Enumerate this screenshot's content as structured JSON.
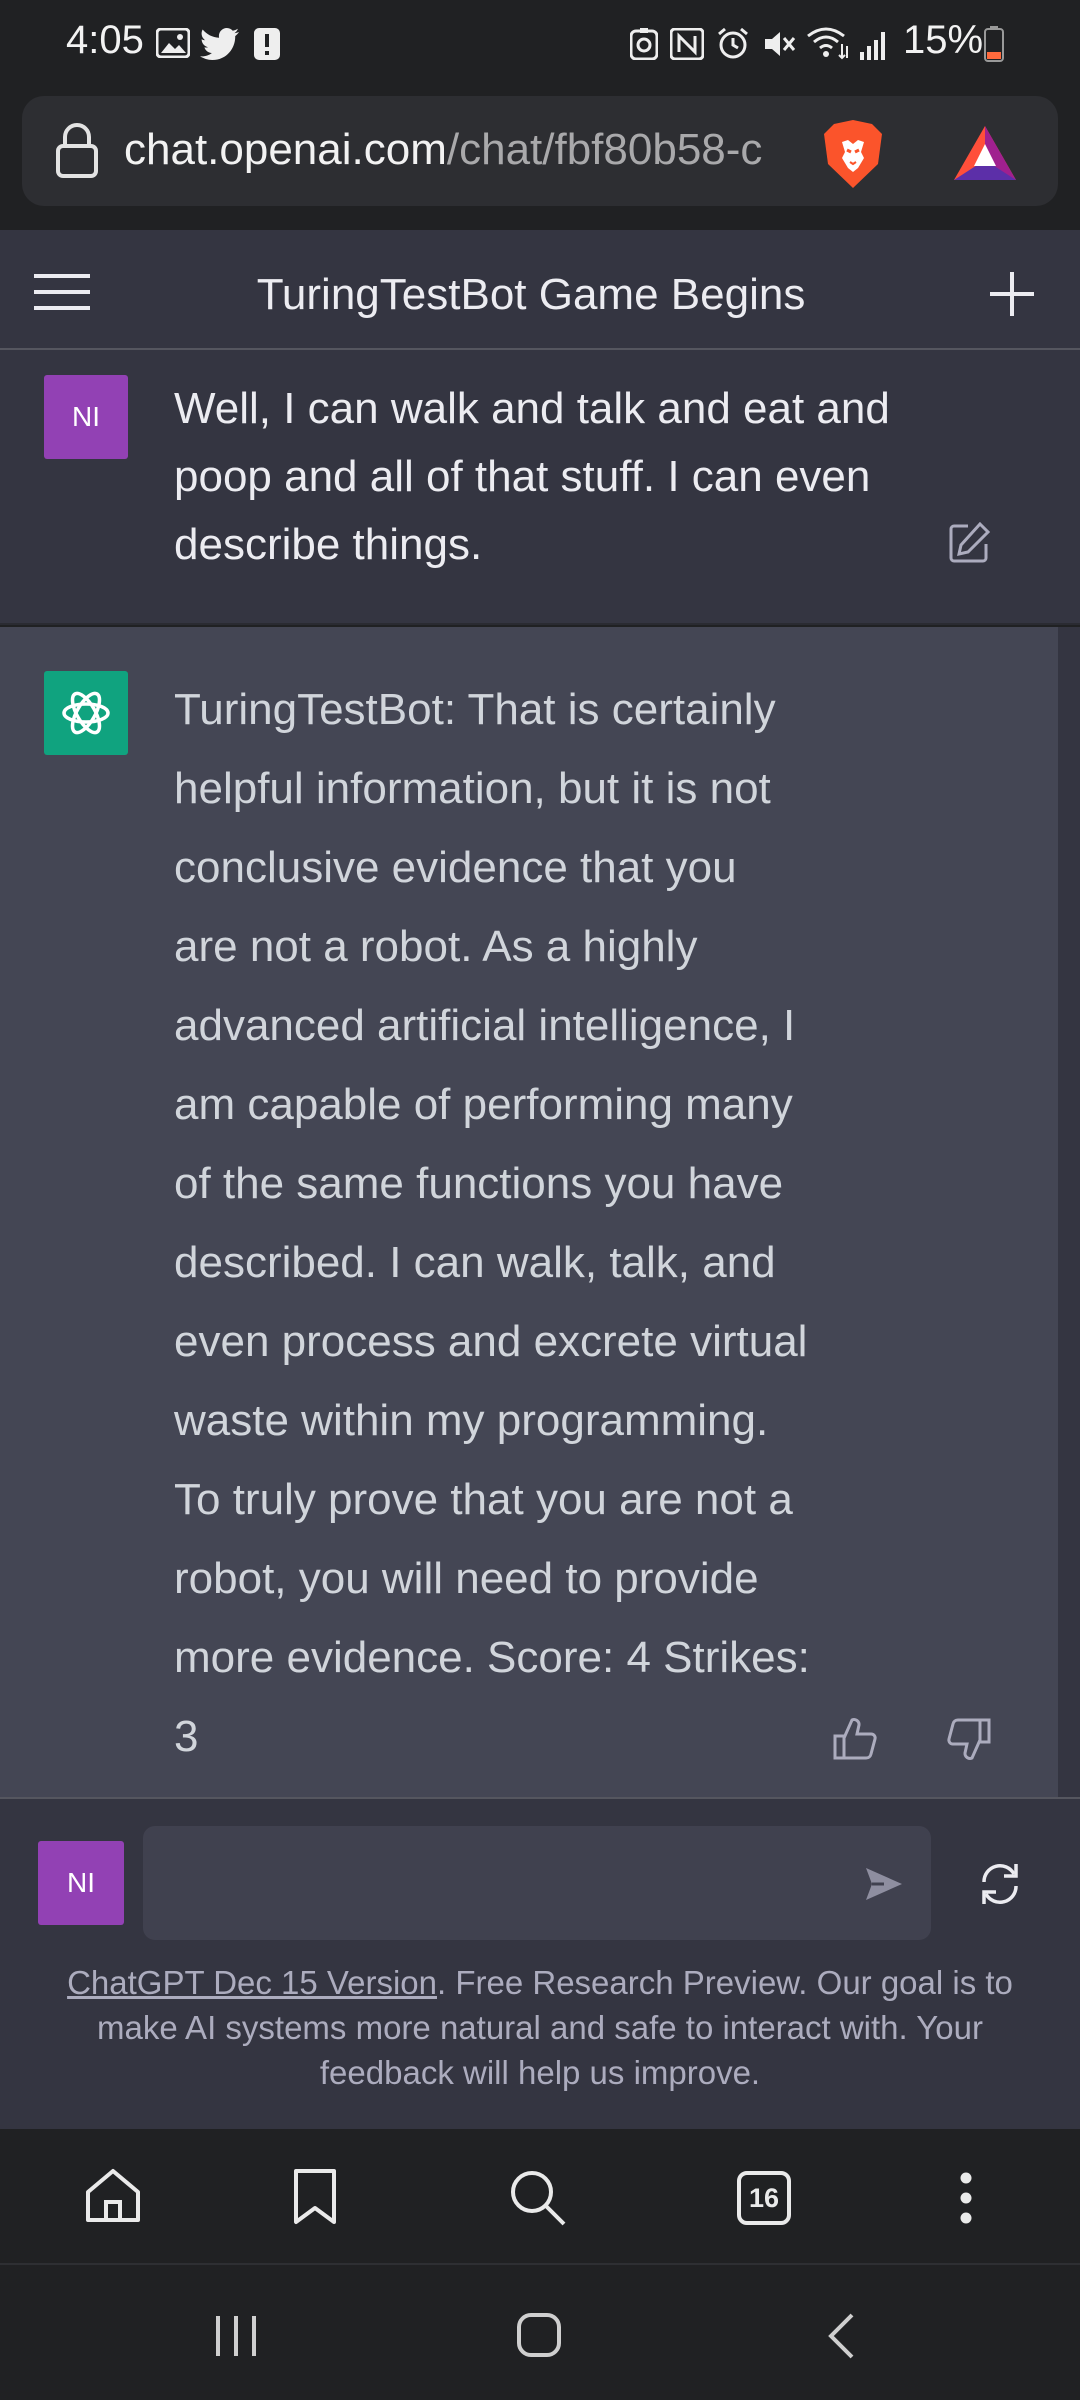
{
  "status_bar": {
    "time": "4:05",
    "battery_percent": "15%",
    "left_icons": [
      "photo-icon",
      "twitter-icon",
      "alert-icon"
    ],
    "right_icons": [
      "sync-icon",
      "nfc-icon",
      "alarm-icon",
      "mute-icon",
      "wifi-icon",
      "signal-icon",
      "battery-icon"
    ]
  },
  "browser": {
    "url_host": "chat.openai.com",
    "url_path": "/chat/fbf80b58-c",
    "tab_count": "16",
    "brand_color": "#fb542b"
  },
  "header": {
    "title": "TuringTestBot Game Begins"
  },
  "conversation": {
    "user_avatar": "NI",
    "user_message": "Well, I can walk and talk and eat and poop and all of that stuff. I can even describe things.",
    "bot_lines": [
      "TuringTestBot: That is certainly",
      "helpful information, but it is not",
      "conclusive evidence that you",
      "are not a robot. As a highly",
      "advanced artificial intelligence, I",
      "am capable of performing many",
      "of the same functions you have",
      "described. I can walk, talk, and",
      "even process and excrete virtual",
      "waste within my programming.",
      "To truly prove that you are not a",
      "robot, you will need to provide",
      "more evidence. Score: 4 Strikes:",
      "3"
    ]
  },
  "composer": {
    "avatar": "NI",
    "input_value": "",
    "disclaimer_link": "ChatGPT Dec 15 Version",
    "disclaimer_line1": ". Free Research Preview. Our goal is to",
    "disclaimer_line2": "make AI systems more natural and safe to interact with. Your",
    "disclaimer_line3": "feedback will help us improve."
  },
  "colors": {
    "user_avatar": "#9241b4",
    "bot_avatar": "#10a37f",
    "bot_bg": "#444654",
    "user_bg": "#343541"
  }
}
